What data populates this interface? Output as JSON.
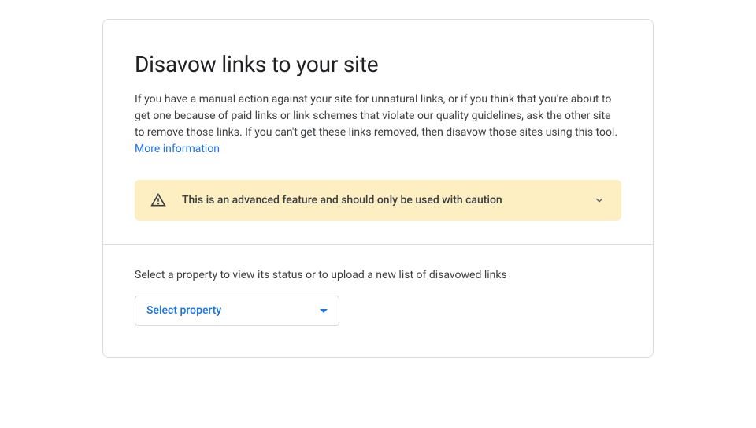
{
  "header": {
    "title": "Disavow links to your site",
    "description": "If you have a manual action against your site for unnatural links, or if you think that you're about to get one because of paid links or link schemes that violate our quality guidelines, ask the other site to remove those links. If you can't get these links removed, then disavow those sites using this tool. ",
    "more_info_label": "More information"
  },
  "warning": {
    "text": "This is an advanced feature and should only be used with caution"
  },
  "property_section": {
    "instruction": "Select a property to view its status or to upload a new list of disavowed links",
    "select_placeholder": "Select property"
  }
}
